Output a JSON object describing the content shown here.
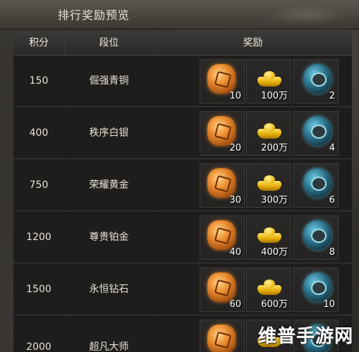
{
  "window": {
    "title": "排行奖励预览"
  },
  "table": {
    "headers": {
      "points": "积分",
      "rank": "段位",
      "reward": "奖励"
    },
    "rows": [
      {
        "points": "150",
        "rank": "倔强青铜",
        "rewards": [
          "10",
          "100万",
          "2"
        ]
      },
      {
        "points": "400",
        "rank": "秩序白银",
        "rewards": [
          "20",
          "200万",
          "4"
        ]
      },
      {
        "points": "750",
        "rank": "荣耀黄金",
        "rewards": [
          "30",
          "300万",
          "6"
        ]
      },
      {
        "points": "1200",
        "rank": "尊贵铂金",
        "rewards": [
          "40",
          "400万",
          "8"
        ]
      },
      {
        "points": "1500",
        "rank": "永恒钻石",
        "rewards": [
          "60",
          "600万",
          "10"
        ]
      },
      {
        "points": "2000",
        "rank": "超凡大师",
        "rewards": [
          "",
          "",
          ""
        ]
      }
    ]
  },
  "reward_icons": [
    "amber-gem-icon",
    "gold-ingot-icon",
    "spirit-orb-icon"
  ],
  "watermark": "维普手游网",
  "colors": {
    "text": "#ebe4d6",
    "gem": "#e8892c",
    "gold": "#f0c020",
    "orb": "#2a7088"
  }
}
